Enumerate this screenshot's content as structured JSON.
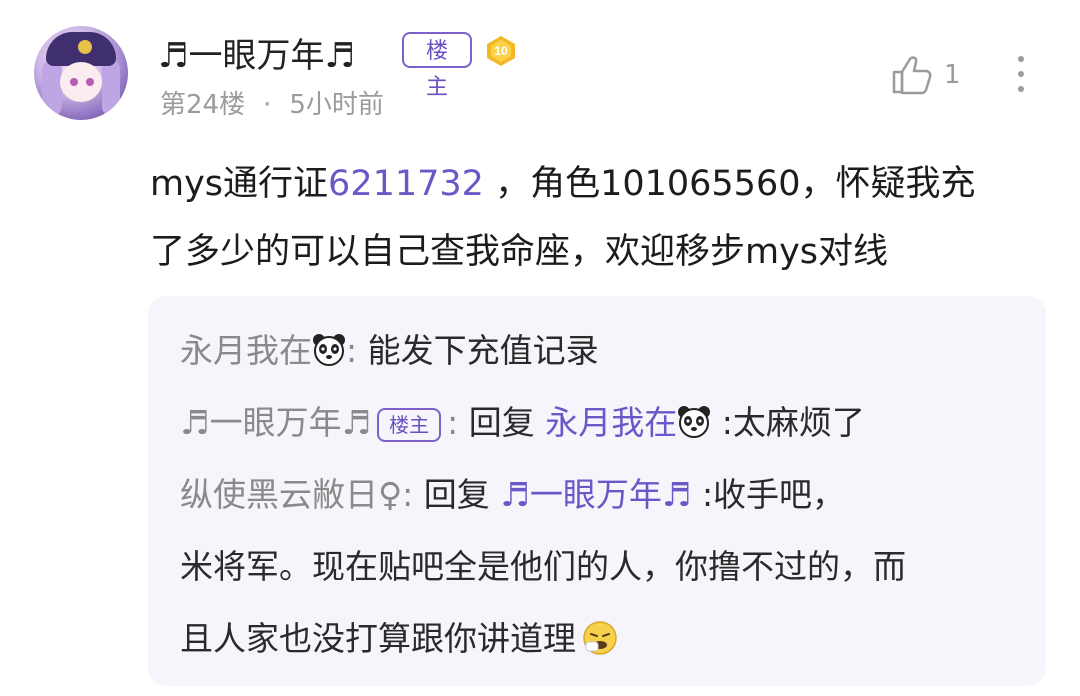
{
  "post": {
    "username": "♬一眼万年♬",
    "owner_label": "楼主",
    "level": "10",
    "floor": "第24楼",
    "separator": "·",
    "time": "5小时前",
    "likes": "1",
    "content_prefix": "mys通行证",
    "content_link": "6211732",
    "content_rest_line1": " ，角色101065560，怀疑我充",
    "content_line2": "了多少的可以自己查我命座，欢迎移步mys对线"
  },
  "replies": [
    {
      "name": "永月我在",
      "colon": ": ",
      "text": "能发下充值记录"
    },
    {
      "name": "♬一眼万年♬",
      "owner_label": "楼主",
      "colon": ": ",
      "reply_word": "回复 ",
      "target": "永月我在",
      "text": " :太麻烦了"
    },
    {
      "name": "纵使黑云敝日♀",
      "colon": ": ",
      "reply_word": "回复 ",
      "target": "♬一眼万年♬",
      "text_line1": " :收手吧，",
      "text_line2": "米将军。现在贴吧全是他们的人，你撸不过的，而",
      "text_line3": "且人家也没打算跟你讲道理"
    }
  ],
  "colors": {
    "accent": "#6d57c8",
    "muted": "#9b9b9b",
    "reply_bg": "#f5f5fb"
  }
}
